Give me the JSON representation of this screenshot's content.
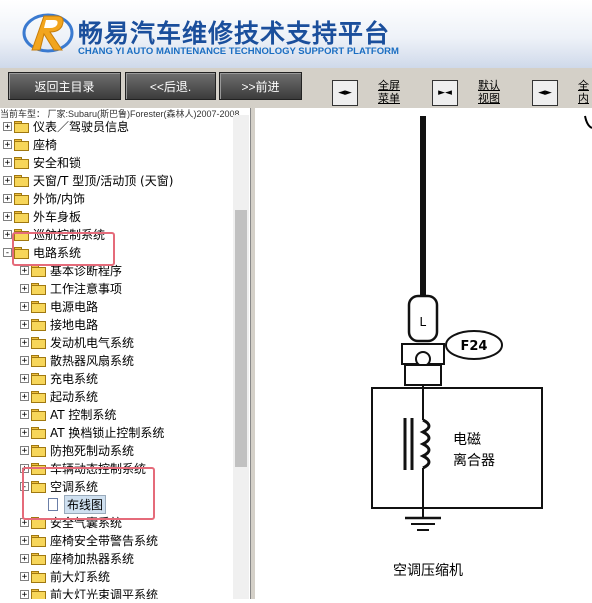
{
  "header": {
    "title": "畅易汽车维修技术支持平台",
    "subtitle": "CHANG YI AUTO MAINTENANCE TECHNOLOGY SUPPORT PLATFORM"
  },
  "toolbar": {
    "home_label": "返回主目录",
    "back_label": "<<后退.",
    "forward_label": ">>前进",
    "fullscreen_label_1": "全屏",
    "fullscreen_label_2": "菜单",
    "default_label_1": "默认",
    "default_label_2": "视图",
    "full_content_label_1": "全",
    "full_content_label_2": "内"
  },
  "breadcrumb": "当前车型： 厂家:Subaru(斯巴鲁)Forester(森林人)2007-2008",
  "tree": [
    {
      "label": "仪表／驾驶员信息",
      "level": 0,
      "expander": "+",
      "type": "folder"
    },
    {
      "label": "座椅",
      "level": 0,
      "expander": "+",
      "type": "folder"
    },
    {
      "label": "安全和锁",
      "level": 0,
      "expander": "+",
      "type": "folder"
    },
    {
      "label": "天窗/T 型顶/活动顶 (天窗)",
      "level": 0,
      "expander": "+",
      "type": "folder"
    },
    {
      "label": "外饰/内饰",
      "level": 0,
      "expander": "+",
      "type": "folder"
    },
    {
      "label": "外车身板",
      "level": 0,
      "expander": "+",
      "type": "folder"
    },
    {
      "label": "巡航控制系统",
      "level": 0,
      "expander": "+",
      "type": "folder"
    },
    {
      "label": "电路系统",
      "level": 0,
      "expander": "-",
      "type": "folder"
    },
    {
      "label": "基本诊断程序",
      "level": 1,
      "expander": "+",
      "type": "folder"
    },
    {
      "label": "工作注意事项",
      "level": 1,
      "expander": "+",
      "type": "folder"
    },
    {
      "label": "电源电路",
      "level": 1,
      "expander": "+",
      "type": "folder"
    },
    {
      "label": "接地电路",
      "level": 1,
      "expander": "+",
      "type": "folder"
    },
    {
      "label": "发动机电气系统",
      "level": 1,
      "expander": "+",
      "type": "folder"
    },
    {
      "label": "散热器风扇系统",
      "level": 1,
      "expander": "+",
      "type": "folder"
    },
    {
      "label": "充电系统",
      "level": 1,
      "expander": "+",
      "type": "folder"
    },
    {
      "label": "起动系统",
      "level": 1,
      "expander": "+",
      "type": "folder"
    },
    {
      "label": "AT 控制系统",
      "level": 1,
      "expander": "+",
      "type": "folder"
    },
    {
      "label": "AT 换档锁止控制系统",
      "level": 1,
      "expander": "+",
      "type": "folder"
    },
    {
      "label": "防抱死制动系统",
      "level": 1,
      "expander": "+",
      "type": "folder"
    },
    {
      "label": "车辆动态控制系统",
      "level": 1,
      "expander": "+",
      "type": "folder"
    },
    {
      "label": "空调系统",
      "level": 1,
      "expander": "-",
      "type": "folder"
    },
    {
      "label": "布线图",
      "level": 2,
      "expander": "",
      "type": "doc",
      "selected": true
    },
    {
      "label": "安全气囊系统",
      "level": 1,
      "expander": "+",
      "type": "folder"
    },
    {
      "label": "座椅安全带警告系统",
      "level": 1,
      "expander": "+",
      "type": "folder"
    },
    {
      "label": "座椅加热器系统",
      "level": 1,
      "expander": "+",
      "type": "folder"
    },
    {
      "label": "前大灯系统",
      "level": 1,
      "expander": "+",
      "type": "folder"
    },
    {
      "label": "前大灯光束调平系统",
      "level": 1,
      "expander": "+",
      "type": "folder"
    }
  ],
  "diagram": {
    "connector_id": "F24",
    "component_label_1": "电磁",
    "component_label_2": "离合器",
    "device_label": "空调压缩机"
  },
  "colors": {
    "highlight": "#e56b7a",
    "title": "#1b4f9c"
  }
}
